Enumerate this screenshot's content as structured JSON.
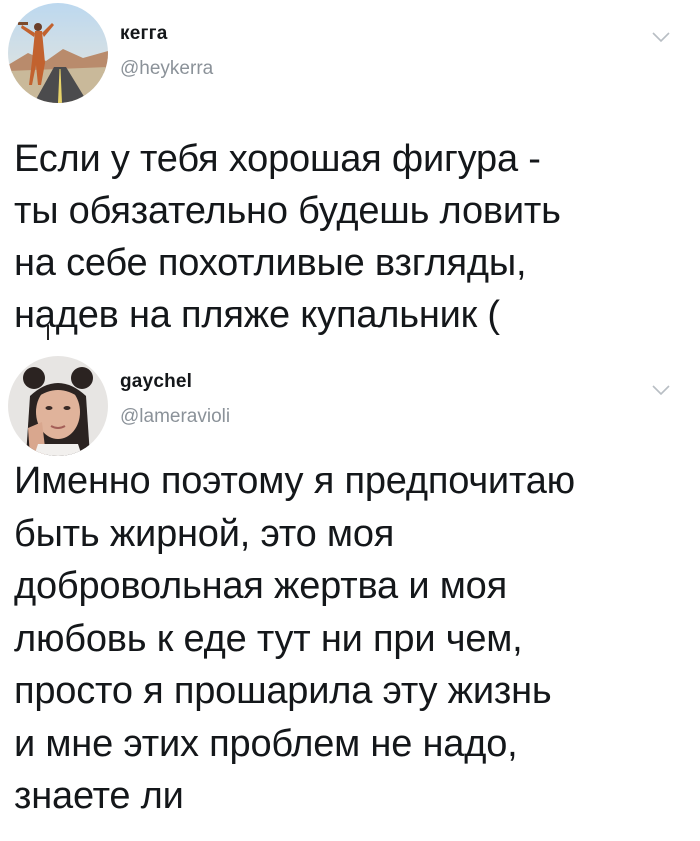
{
  "tweets": [
    {
      "author_name": "кегга",
      "author_handle": "@heykerra",
      "text": "Если у тебя хорошая фигура -\nты обязательно будешь ловить\nна себе похотливые взгляды,\nнадев на пляже купальник ("
    },
    {
      "author_name": "gaychel",
      "author_handle": "@lameravioli",
      "text": "Именно поэтому я предпочитаю\nбыть жирной, это моя\nдобровольная жертва и моя\nлюбовь к еде тут ни при чем,\nпросто я прошарила эту жизнь\nи мне этих проблем не надо,\nзнаете ли"
    }
  ],
  "colors": {
    "text": "#14171a",
    "secondary": "#8b9299",
    "chevron": "#b8bec4"
  },
  "icons": {
    "menu": "chevron-down-icon"
  }
}
